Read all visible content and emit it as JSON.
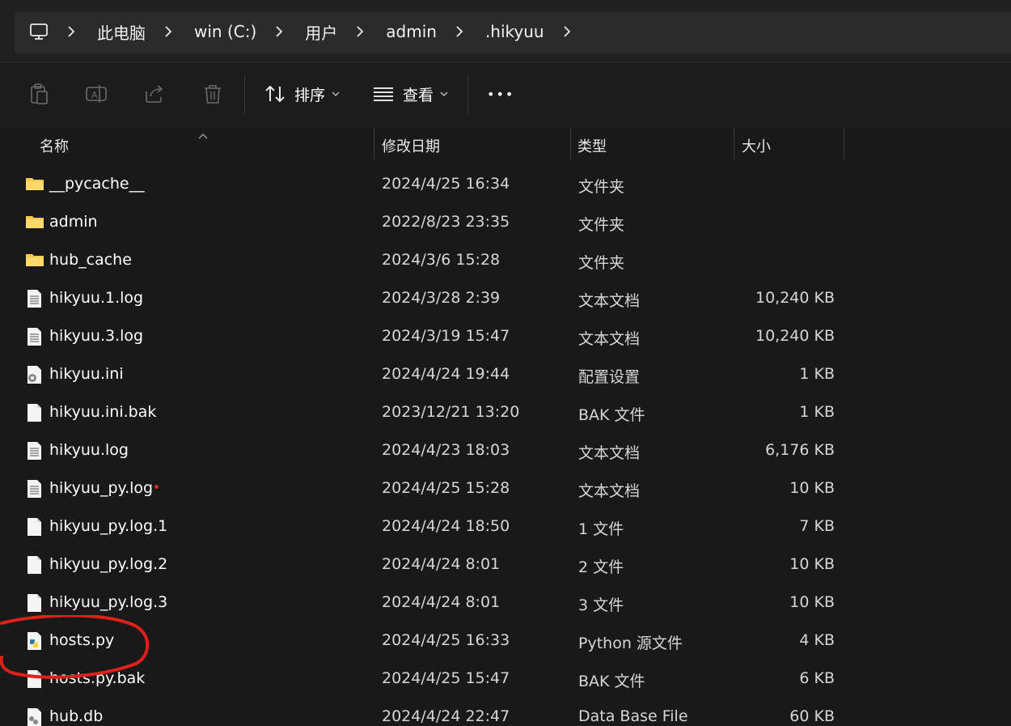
{
  "breadcrumb": {
    "items": [
      "此电脑",
      "win (C:)",
      "用户",
      "admin",
      ".hikyuu"
    ]
  },
  "toolbar": {
    "sort_label": "排序",
    "view_label": "查看",
    "more_label": "•••"
  },
  "columns": {
    "name": "名称",
    "date": "修改日期",
    "type": "类型",
    "size": "大小"
  },
  "files": [
    {
      "name": "__pycache__",
      "date": "2024/4/25 16:34",
      "type": "文件夹",
      "size": "",
      "icon": "folder-icon"
    },
    {
      "name": "admin",
      "date": "2022/8/23 23:35",
      "type": "文件夹",
      "size": "",
      "icon": "folder-icon"
    },
    {
      "name": "hub_cache",
      "date": "2024/3/6 15:28",
      "type": "文件夹",
      "size": "",
      "icon": "folder-icon"
    },
    {
      "name": "hikyuu.1.log",
      "date": "2024/3/28 2:39",
      "type": "文本文档",
      "size": "10,240 KB",
      "icon": "text-file-icon"
    },
    {
      "name": "hikyuu.3.log",
      "date": "2024/3/19 15:47",
      "type": "文本文档",
      "size": "10,240 KB",
      "icon": "text-file-icon"
    },
    {
      "name": "hikyuu.ini",
      "date": "2024/4/24 19:44",
      "type": "配置设置",
      "size": "1 KB",
      "icon": "settings-file-icon"
    },
    {
      "name": "hikyuu.ini.bak",
      "date": "2023/12/21 13:20",
      "type": "BAK 文件",
      "size": "1 KB",
      "icon": "blank-file-icon"
    },
    {
      "name": "hikyuu.log",
      "date": "2024/4/23 18:03",
      "type": "文本文档",
      "size": "6,176 KB",
      "icon": "text-file-icon"
    },
    {
      "name": "hikyuu_py.log",
      "date": "2024/4/25 15:28",
      "type": "文本文档",
      "size": "10 KB",
      "icon": "text-file-icon"
    },
    {
      "name": "hikyuu_py.log.1",
      "date": "2024/4/24 18:50",
      "type": "1 文件",
      "size": "7 KB",
      "icon": "blank-file-icon"
    },
    {
      "name": "hikyuu_py.log.2",
      "date": "2024/4/24 8:01",
      "type": "2 文件",
      "size": "10 KB",
      "icon": "blank-file-icon"
    },
    {
      "name": "hikyuu_py.log.3",
      "date": "2024/4/24 8:01",
      "type": "3 文件",
      "size": "10 KB",
      "icon": "blank-file-icon"
    },
    {
      "name": "hosts.py",
      "date": "2024/4/25 16:33",
      "type": "Python 源文件",
      "size": "4 KB",
      "icon": "python-file-icon"
    },
    {
      "name": "hosts.py.bak",
      "date": "2024/4/25 15:47",
      "type": "BAK 文件",
      "size": "6 KB",
      "icon": "blank-file-icon"
    },
    {
      "name": "hub.db",
      "date": "2024/4/24 22:47",
      "type": "Data Base File",
      "size": "60 KB",
      "icon": "database-file-icon"
    }
  ],
  "colors": {
    "folder": "#f8c94a",
    "annotation": "#e0201a",
    "accent_dot": "#d9281e"
  }
}
